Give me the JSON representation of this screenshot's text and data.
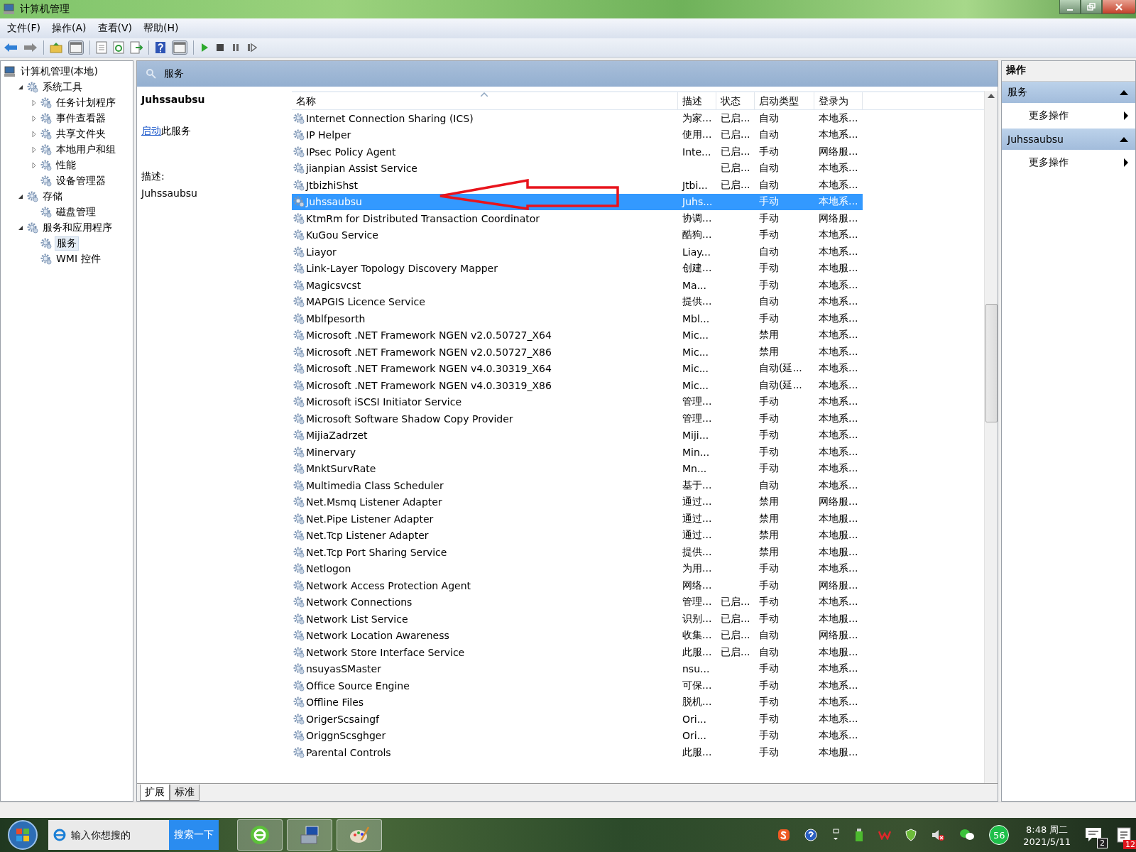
{
  "window": {
    "title": "计算机管理"
  },
  "menu": [
    "文件(F)",
    "操作(A)",
    "查看(V)",
    "帮助(H)"
  ],
  "tree": [
    {
      "label": "计算机管理(本地)",
      "kind": "root",
      "selected": false,
      "children": [
        {
          "label": "系统工具",
          "kind": "node",
          "expanded": true,
          "selected": false,
          "children": [
            {
              "label": "任务计划程序",
              "kind": "node",
              "expanded": false,
              "selected": false
            },
            {
              "label": "事件查看器",
              "kind": "node",
              "expanded": false,
              "selected": false
            },
            {
              "label": "共享文件夹",
              "kind": "node",
              "expanded": false,
              "selected": false
            },
            {
              "label": "本地用户和组",
              "kind": "node",
              "expanded": false,
              "selected": false
            },
            {
              "label": "性能",
              "kind": "node",
              "expanded": false,
              "selected": false
            },
            {
              "label": "设备管理器",
              "kind": "leaf",
              "selected": false
            }
          ]
        },
        {
          "label": "存储",
          "kind": "node",
          "expanded": true,
          "selected": false,
          "children": [
            {
              "label": "磁盘管理",
              "kind": "leaf",
              "selected": false
            }
          ]
        },
        {
          "label": "服务和应用程序",
          "kind": "node",
          "expanded": true,
          "selected": false,
          "children": [
            {
              "label": "服务",
              "kind": "leaf",
              "selected": true
            },
            {
              "label": "WMI 控件",
              "kind": "leaf",
              "selected": false
            }
          ]
        }
      ]
    }
  ],
  "panel": {
    "title": "服务"
  },
  "detail": {
    "name": "Juhssaubsu",
    "action_link": "启动",
    "action_text": "此服务",
    "description_label": "描述:",
    "description": "Juhssaubsu"
  },
  "table": {
    "columns": [
      "名称",
      "描述",
      "状态",
      "启动类型",
      "登录为"
    ],
    "rows": [
      {
        "name": "Internet Connection Sharing (ICS)",
        "description": "为家...",
        "status": "已启...",
        "startup": "自动",
        "logon": "本地系...",
        "selected": false
      },
      {
        "name": "IP Helper",
        "description": "使用...",
        "status": "已启...",
        "startup": "自动",
        "logon": "本地系...",
        "selected": false
      },
      {
        "name": "IPsec Policy Agent",
        "description": "Inte...",
        "status": "已启...",
        "startup": "手动",
        "logon": "网络服...",
        "selected": false
      },
      {
        "name": "jianpian Assist Service",
        "status": "已启...",
        "startup": "自动",
        "logon": "本地系...",
        "selected": false
      },
      {
        "name": "JtbizhiShst",
        "description": "Jtbi...",
        "status": "已启...",
        "startup": "自动",
        "logon": "本地系...",
        "selected": false
      },
      {
        "name": "Juhssaubsu",
        "description": "Juhs...",
        "startup": "手动",
        "logon": "本地系...",
        "selected": true
      },
      {
        "name": "KtmRm for Distributed Transaction Coordinator",
        "description": "协调...",
        "startup": "手动",
        "logon": "网络服...",
        "selected": false
      },
      {
        "name": "KuGou Service",
        "description": "酷狗...",
        "startup": "手动",
        "logon": "本地系...",
        "selected": false
      },
      {
        "name": "Liayor",
        "description": "Liay...",
        "startup": "自动",
        "logon": "本地系...",
        "selected": false
      },
      {
        "name": "Link-Layer Topology Discovery Mapper",
        "description": "创建...",
        "startup": "手动",
        "logon": "本地服...",
        "selected": false
      },
      {
        "name": "Magicsvcst",
        "description": "Ma...",
        "startup": "手动",
        "logon": "本地系...",
        "selected": false
      },
      {
        "name": "MAPGIS Licence Service",
        "description": "提供...",
        "startup": "自动",
        "logon": "本地系...",
        "selected": false
      },
      {
        "name": "Mblfpesorth",
        "description": "Mbl...",
        "startup": "手动",
        "logon": "本地系...",
        "selected": false
      },
      {
        "name": "Microsoft .NET Framework NGEN v2.0.50727_X64",
        "description": "Mic...",
        "startup": "禁用",
        "logon": "本地系...",
        "selected": false
      },
      {
        "name": "Microsoft .NET Framework NGEN v2.0.50727_X86",
        "description": "Mic...",
        "startup": "禁用",
        "logon": "本地系...",
        "selected": false
      },
      {
        "name": "Microsoft .NET Framework NGEN v4.0.30319_X64",
        "description": "Mic...",
        "startup": "自动(延...",
        "logon": "本地系...",
        "selected": false
      },
      {
        "name": "Microsoft .NET Framework NGEN v4.0.30319_X86",
        "description": "Mic...",
        "startup": "自动(延...",
        "logon": "本地系...",
        "selected": false
      },
      {
        "name": "Microsoft iSCSI Initiator Service",
        "description": "管理...",
        "startup": "手动",
        "logon": "本地系...",
        "selected": false
      },
      {
        "name": "Microsoft Software Shadow Copy Provider",
        "description": "管理...",
        "startup": "手动",
        "logon": "本地系...",
        "selected": false
      },
      {
        "name": "MijiaZadrzet",
        "description": "Miji...",
        "startup": "手动",
        "logon": "本地系...",
        "selected": false
      },
      {
        "name": "Minervary",
        "description": "Min...",
        "startup": "手动",
        "logon": "本地系...",
        "selected": false
      },
      {
        "name": "MnktSurvRate",
        "description": "Mn...",
        "startup": "手动",
        "logon": "本地系...",
        "selected": false
      },
      {
        "name": "Multimedia Class Scheduler",
        "description": "基于...",
        "startup": "自动",
        "logon": "本地系...",
        "selected": false
      },
      {
        "name": "Net.Msmq Listener Adapter",
        "description": "通过...",
        "startup": "禁用",
        "logon": "网络服...",
        "selected": false
      },
      {
        "name": "Net.Pipe Listener Adapter",
        "description": "通过...",
        "startup": "禁用",
        "logon": "本地服...",
        "selected": false
      },
      {
        "name": "Net.Tcp Listener Adapter",
        "description": "通过...",
        "startup": "禁用",
        "logon": "本地服...",
        "selected": false
      },
      {
        "name": "Net.Tcp Port Sharing Service",
        "description": "提供...",
        "startup": "禁用",
        "logon": "本地服...",
        "selected": false
      },
      {
        "name": "Netlogon",
        "description": "为用...",
        "startup": "手动",
        "logon": "本地系...",
        "selected": false
      },
      {
        "name": "Network Access Protection Agent",
        "description": "网络...",
        "startup": "手动",
        "logon": "网络服...",
        "selected": false
      },
      {
        "name": "Network Connections",
        "description": "管理...",
        "status": "已启...",
        "startup": "手动",
        "logon": "本地系...",
        "selected": false
      },
      {
        "name": "Network List Service",
        "description": "识别...",
        "status": "已启...",
        "startup": "手动",
        "logon": "本地服...",
        "selected": false
      },
      {
        "name": "Network Location Awareness",
        "description": "收集...",
        "status": "已启...",
        "startup": "自动",
        "logon": "网络服...",
        "selected": false
      },
      {
        "name": "Network Store Interface Service",
        "description": "此服...",
        "status": "已启...",
        "startup": "自动",
        "logon": "本地服...",
        "selected": false
      },
      {
        "name": "nsuyasSMaster",
        "description": "nsu...",
        "startup": "手动",
        "logon": "本地系...",
        "selected": false
      },
      {
        "name": "Office Source Engine",
        "description": "可保...",
        "startup": "手动",
        "logon": "本地系...",
        "selected": false
      },
      {
        "name": "Offline Files",
        "description": "脱机...",
        "startup": "手动",
        "logon": "本地系...",
        "selected": false
      },
      {
        "name": "OrigerScsaingf",
        "description": "Ori...",
        "startup": "手动",
        "logon": "本地系...",
        "selected": false
      },
      {
        "name": "OriggnScsghger",
        "description": "Ori...",
        "startup": "手动",
        "logon": "本地系...",
        "selected": false
      },
      {
        "name": "Parental Controls",
        "description": "此服...",
        "startup": "手动",
        "logon": "本地服...",
        "selected": false
      }
    ]
  },
  "view_tabs": [
    {
      "label": "扩展",
      "selected": true
    },
    {
      "label": "标准",
      "selected": false
    }
  ],
  "actions": {
    "title": "操作",
    "sections": [
      {
        "title": "服务",
        "expanded": true,
        "items": [
          "更多操作"
        ]
      },
      {
        "title": "Juhssaubsu",
        "expanded": true,
        "items": [
          "更多操作"
        ]
      }
    ]
  },
  "taskbar": {
    "search_placeholder": "输入你想搜的",
    "search_button": "搜索一下",
    "tray_badge": "56",
    "time": "8:48 周二",
    "date": "2021/5/11",
    "message_count": "2",
    "notes_count": "12"
  }
}
